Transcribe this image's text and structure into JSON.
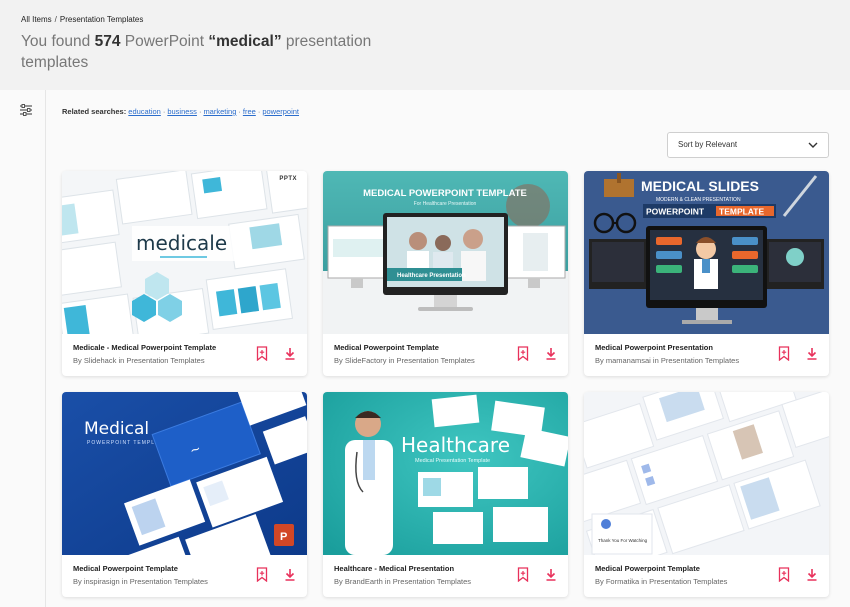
{
  "breadcrumb": {
    "home": "All Items",
    "separator": "/",
    "current": "Presentation Templates"
  },
  "header": {
    "title_prefix": "You found",
    "count": "574",
    "title_middle": "PowerPoint",
    "query": "“medical”",
    "title_suffix": "presentation templates"
  },
  "related": {
    "label": "Related searches:",
    "links": [
      "education",
      "business",
      "marketing",
      "free",
      "powerpoint"
    ]
  },
  "sort": {
    "label": "Sort by Relevant"
  },
  "cards": [
    {
      "title": "Medicale - Medical Powerpoint Template",
      "byline": "By Slidehack in Presentation Templates",
      "badge": "PPTX",
      "art_title": "medicale"
    },
    {
      "title": "Medical Powerpoint Template",
      "byline": "By SlideFactory in Presentation Templates",
      "art_title": "MEDICAL POWERPOINT TEMPLATE",
      "art_subtitle": "For Healthcare Presentation",
      "art_caption": "Healthcare Presentation"
    },
    {
      "title": "Medical Powerpoint Presentation",
      "byline": "By mamanamsai in Presentation Templates",
      "art_title": "MEDICAL SLIDES",
      "art_subtitle": "MODERN & CLEAN PRESENTATION",
      "art_tag_a": "POWERPOINT",
      "art_tag_b": "TEMPLATE"
    },
    {
      "title": "Medical Powerpoint Template",
      "byline": "By inspirasign in Presentation Templates",
      "art_title": "Medical",
      "art_subtitle": "POWERPOINT TEMPLATE"
    },
    {
      "title": "Healthcare - Medical Presentation",
      "byline": "By BrandEarth in Presentation Templates",
      "art_title": "Healthcare",
      "art_subtitle": "Medical Presentation Template"
    },
    {
      "title": "Medical Powerpoint Template",
      "byline": "By Formatika in Presentation Templates",
      "art_title": "Thank You For Watching"
    }
  ],
  "colors": {
    "accent": "#e8315b",
    "link": "#2b6dcc"
  }
}
